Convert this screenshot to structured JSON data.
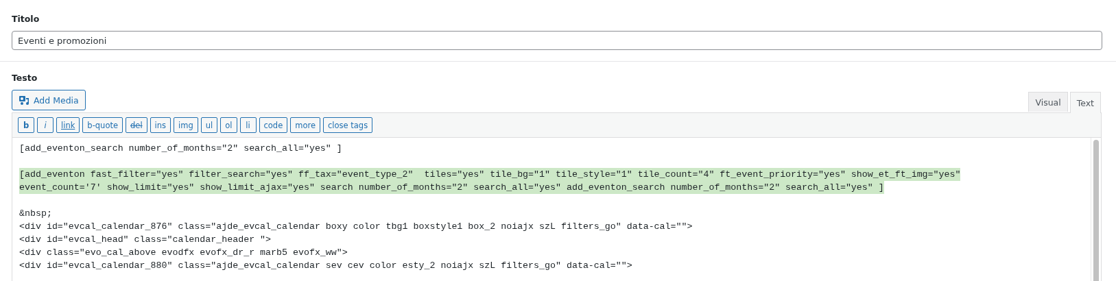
{
  "title_field": {
    "label": "Titolo",
    "value": "Eventi e promozioni"
  },
  "content": {
    "label": "Testo",
    "add_media": "Add Media",
    "tabs": [
      {
        "label": "Visual",
        "selected": false
      },
      {
        "label": "Text",
        "selected": true
      }
    ],
    "quicktags": [
      {
        "label": "b",
        "kind": "bold"
      },
      {
        "label": "i",
        "kind": "italic"
      },
      {
        "label": "link",
        "kind": "link"
      },
      {
        "label": "b-quote",
        "kind": "plain"
      },
      {
        "label": "del",
        "kind": "del"
      },
      {
        "label": "ins",
        "kind": "plain"
      },
      {
        "label": "img",
        "kind": "plain"
      },
      {
        "label": "ul",
        "kind": "plain"
      },
      {
        "label": "ol",
        "kind": "plain"
      },
      {
        "label": "li",
        "kind": "plain"
      },
      {
        "label": "code",
        "kind": "plain"
      },
      {
        "label": "more",
        "kind": "plain"
      },
      {
        "label": "close tags",
        "kind": "plain"
      }
    ],
    "paragraphs": [
      {
        "selected": false,
        "lines": [
          "[add_eventon_search number_of_months=\"2\" search_all=\"yes\" ]"
        ]
      },
      {
        "selected": true,
        "lines": [
          "[add_eventon fast_filter=\"yes\" filter_search=\"yes\" ff_tax=\"event_type_2\"  tiles=\"yes\" tile_bg=\"1\" tile_style=\"1\" tile_count=\"4\" ft_event_priority=\"yes\" show_et_ft_img=\"yes\"",
          "event_count='7' show_limit=\"yes\" show_limit_ajax=\"yes\" search number_of_months=\"2\" search_all=\"yes\" add_eventon_search number_of_months=\"2\" search_all=\"yes\" ]"
        ]
      },
      {
        "selected": false,
        "lines": [
          "&nbsp;",
          "<div id=\"evcal_calendar_876\" class=\"ajde_evcal_calendar boxy color tbg1 boxstyle1 box_2 noiajx szL filters_go\" data-cal=\"\">",
          "<div id=\"evcal_head\" class=\"calendar_header \">",
          "<div class=\"evo_cal_above evodfx evofx_dr_r marb5 evofx_ww\">",
          "<div id=\"evcal_calendar_880\" class=\"ajde_evcal_calendar sev cev color esty_2 noiajx szL filters_go\" data-cal=\"\">"
        ]
      }
    ]
  }
}
